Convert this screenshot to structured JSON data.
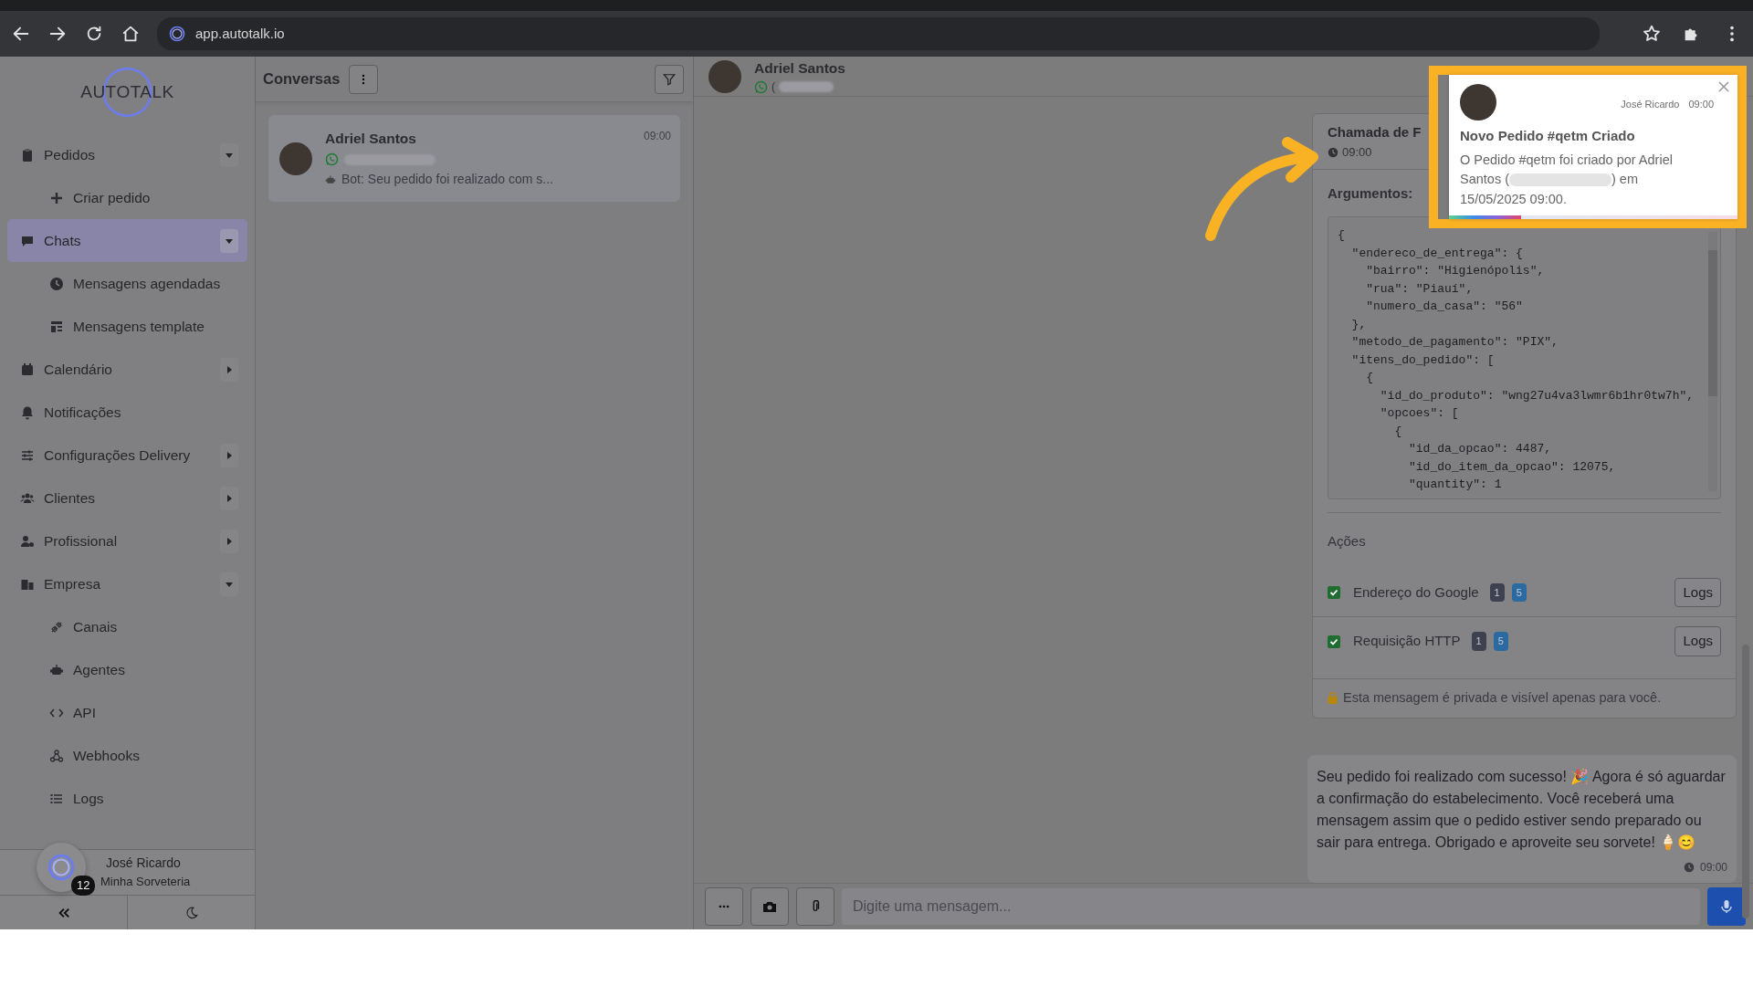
{
  "browser": {
    "url": "app.autotalk.io"
  },
  "sidebar": {
    "logo": "AUTOTALK",
    "items": [
      {
        "kind": "group",
        "label": "Pedidos",
        "selected": false,
        "expanded": true,
        "children": [
          {
            "label": "Criar pedido",
            "selected": false
          }
        ]
      },
      {
        "kind": "group",
        "label": "Chats",
        "selected": true,
        "expanded": true,
        "children": [
          {
            "label": "Mensagens agendadas",
            "selected": false
          },
          {
            "label": "Mensagens template",
            "selected": false
          }
        ]
      },
      {
        "kind": "group",
        "label": "Calendário",
        "selected": false,
        "expanded": false
      },
      {
        "kind": "link",
        "label": "Notificações",
        "selected": false
      },
      {
        "kind": "group",
        "label": "Configurações Delivery",
        "selected": false,
        "expanded": false
      },
      {
        "kind": "group",
        "label": "Clientes",
        "selected": false,
        "expanded": false
      },
      {
        "kind": "group",
        "label": "Profissional",
        "selected": false,
        "expanded": false
      },
      {
        "kind": "group",
        "label": "Empresa",
        "selected": false,
        "expanded": true,
        "children": [
          {
            "label": "Canais",
            "selected": false
          },
          {
            "label": "Agentes",
            "selected": false
          },
          {
            "label": "API",
            "selected": false
          },
          {
            "label": "Webhooks",
            "selected": false
          },
          {
            "label": "Logs",
            "selected": false
          }
        ]
      }
    ],
    "user": {
      "name": "José Ricardo",
      "company": "Minha Sorveteria",
      "badge": "12"
    }
  },
  "conversations": {
    "title": "Conversas",
    "items": [
      {
        "name": "Adriel Santos",
        "time": "09:00",
        "preview": "Bot: Seu pedido foi realizado com s...",
        "selected": true
      }
    ]
  },
  "chat": {
    "contact": {
      "name": "Adriel Santos",
      "phone_prefix": "("
    },
    "function_call": {
      "title": "Chamada de F",
      "time": "09:00",
      "arguments_label": "Argumentos:",
      "code": [
        "{",
        "  \"endereco_de_entrega\": {",
        "    \"bairro\": \"Higienópolis\",",
        "    \"rua\": \"Piauí\",",
        "    \"numero_da_casa\": \"56\"",
        "  },",
        "  \"metodo_de_pagamento\": \"PIX\",",
        "  \"itens_do_pedido\": [",
        "    {",
        "      \"id_do_produto\": \"wng27u4va3lwmr6b1hr0tw7h\",",
        "      \"opcoes\": [",
        "        {",
        "          \"id_da_opcao\": 4487,",
        "          \"id_do_item_da_opcao\": 12075,",
        "          \"quantity\": 1"
      ],
      "actions_title": "Ações",
      "actions": [
        {
          "label": "Endereço do Google",
          "checked": true,
          "count_a": "1",
          "count_b": "5",
          "button": "Logs"
        },
        {
          "label": "Requisição HTTP",
          "checked": true,
          "count_a": "1",
          "count_b": "5",
          "button": "Logs"
        }
      ],
      "private_note": "Esta mensagem é privada e visível apenas para você."
    },
    "message": {
      "text": "Seu pedido foi realizado com sucesso! 🎉 Agora é só aguardar a confirmação do estabelecimento. Você receberá uma mensagem assim que o pedido estiver sendo preparado ou sair para entrega. Obrigado e aproveite seu sorvete! 🍦😊",
      "time": "09:00"
    },
    "composer": {
      "placeholder": "Digite uma mensagem..."
    }
  },
  "notification": {
    "sender": "José Ricardo",
    "time": "09:00",
    "title": "Novo Pedido #qetm Criado",
    "body_start": "O Pedido #qetm foi criado por Adriel Santos (",
    "body_end": ") em 15/05/2025 09:00.",
    "level": 0.25
  }
}
